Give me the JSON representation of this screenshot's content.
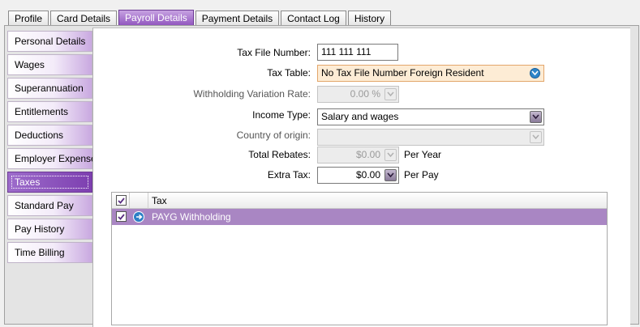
{
  "tabs": [
    {
      "label": "Profile"
    },
    {
      "label": "Card Details"
    },
    {
      "label": "Payroll Details"
    },
    {
      "label": "Payment Details"
    },
    {
      "label": "Contact Log"
    },
    {
      "label": "History"
    }
  ],
  "active_tab": "Payroll Details",
  "sidebar": {
    "items": [
      {
        "label": "Personal Details"
      },
      {
        "label": "Wages"
      },
      {
        "label": "Superannuation"
      },
      {
        "label": "Entitlements"
      },
      {
        "label": "Deductions"
      },
      {
        "label": "Employer Expenses"
      },
      {
        "label": "Taxes"
      },
      {
        "label": "Standard Pay"
      },
      {
        "label": "Pay History"
      },
      {
        "label": "Time Billing"
      }
    ],
    "active": "Taxes"
  },
  "form": {
    "tfn": {
      "label": "Tax File Number:",
      "value": "111 111 111"
    },
    "tax_table": {
      "label": "Tax Table:",
      "value": "No Tax File Number Foreign Resident"
    },
    "withholding": {
      "label": "Withholding Variation Rate:",
      "value": "0.00 %"
    },
    "income_type": {
      "label": "Income Type:",
      "value": "Salary and wages"
    },
    "country": {
      "label": "Country of origin:",
      "value": ""
    },
    "rebates": {
      "label": "Total Rebates:",
      "value": "$0.00",
      "suffix": "Per Year"
    },
    "extra_tax": {
      "label": "Extra Tax:",
      "value": "$0.00",
      "suffix": "Per Pay"
    }
  },
  "grid": {
    "header": {
      "tax": "Tax"
    },
    "rows": [
      {
        "checked": true,
        "tax": "PAYG Withholding"
      }
    ]
  },
  "colors": {
    "accent": "#8f53bd",
    "row_highlight": "#a986c3",
    "highlight_field": "#fdecd5"
  }
}
